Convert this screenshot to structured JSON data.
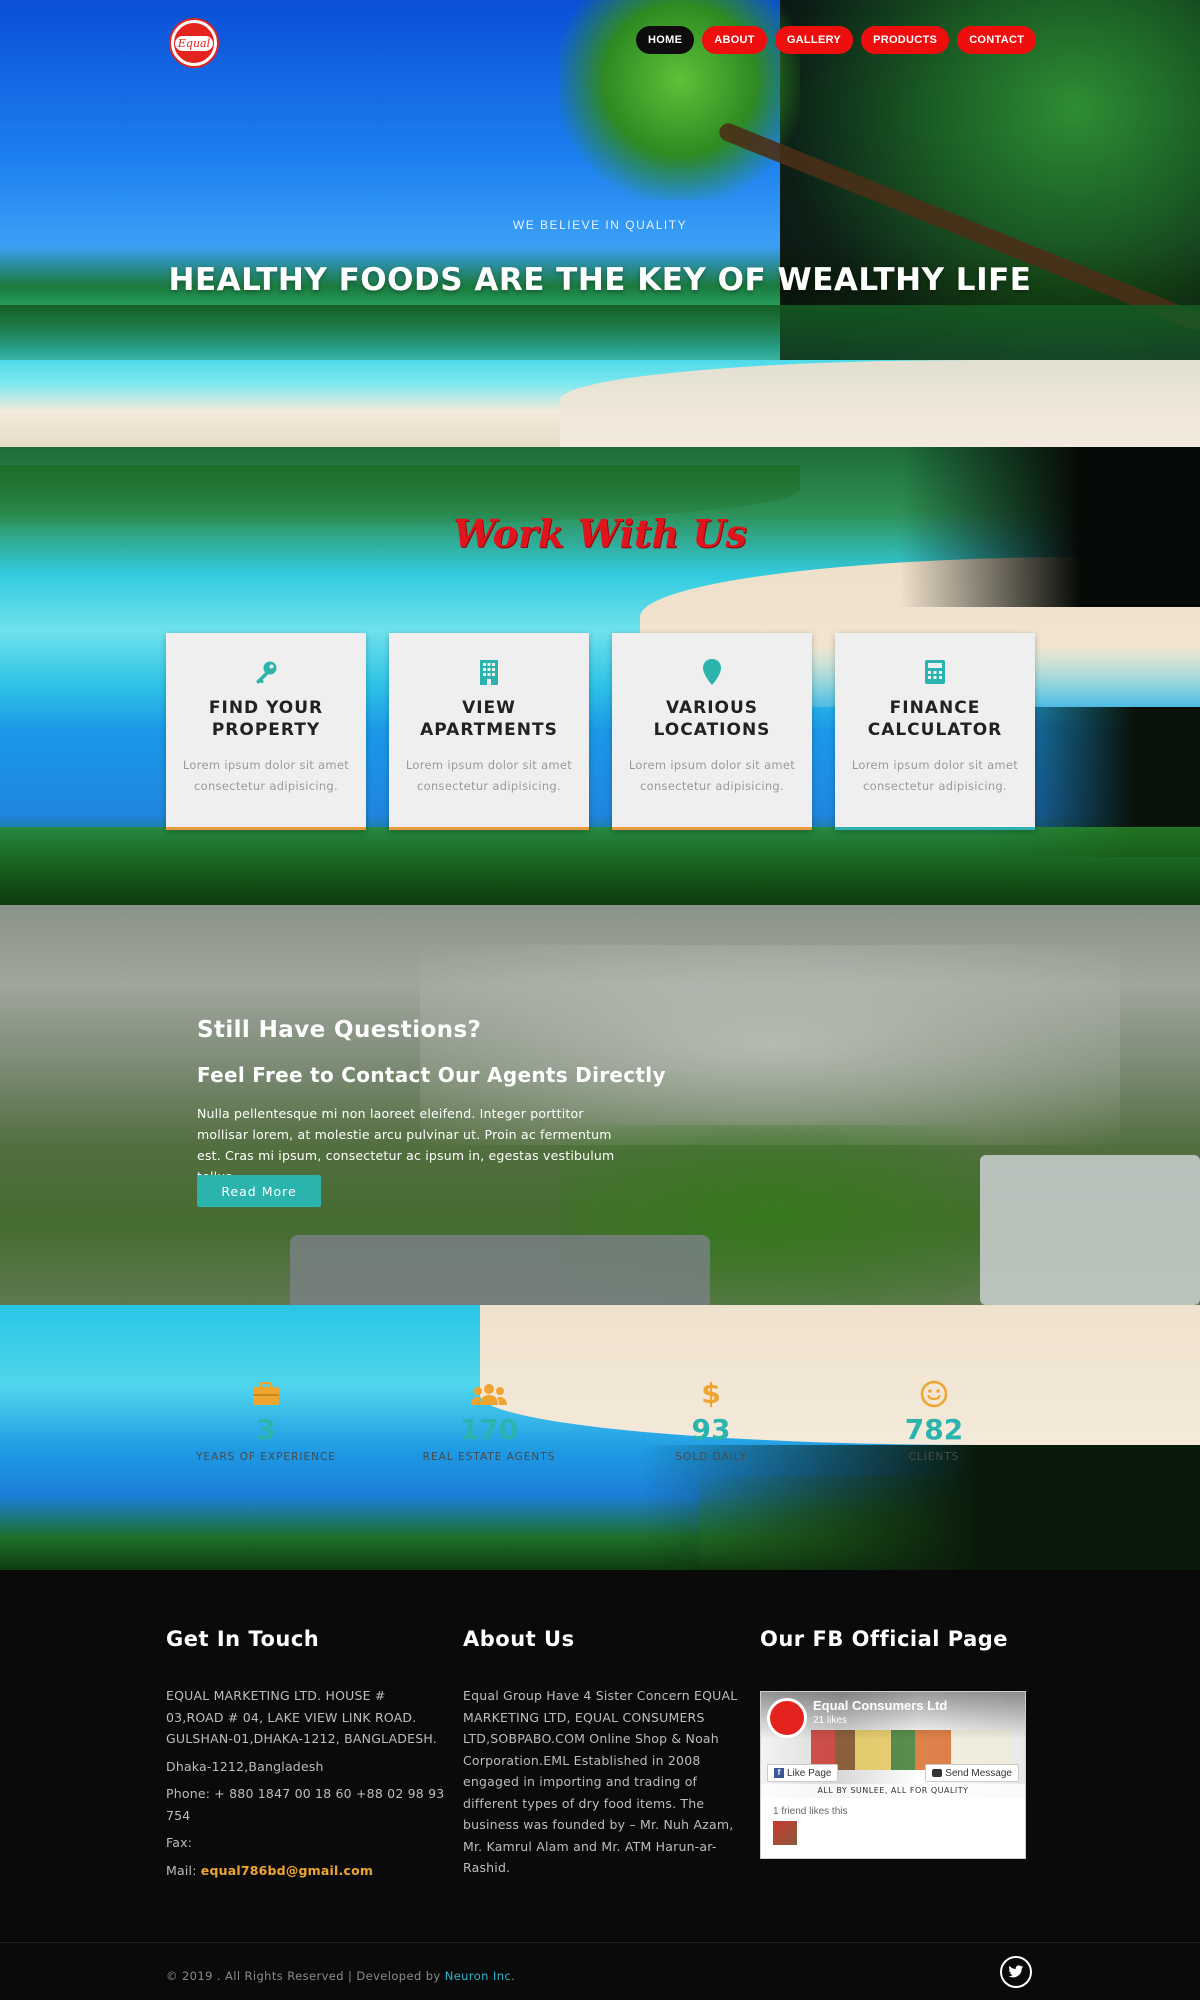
{
  "brand": {
    "logo_text": "Equal"
  },
  "nav": {
    "items": [
      {
        "label": "HOME",
        "active": true
      },
      {
        "label": "ABOUT",
        "active": false
      },
      {
        "label": "GALLERY",
        "active": false
      },
      {
        "label": "PRODUCTS",
        "active": false
      },
      {
        "label": "CONTACT",
        "active": false
      }
    ]
  },
  "hero": {
    "tagline": "WE BELIEVE IN QUALITY",
    "headline": "HEALTHY FOODS ARE THE KEY OF WEALTHY LIFE"
  },
  "work": {
    "title": "Work With Us",
    "cards": [
      {
        "icon": "key-icon",
        "title_line1": "FIND YOUR",
        "title_line2": "PROPERTY",
        "text": "Lorem ipsum dolor sit amet consectetur adipisicing."
      },
      {
        "icon": "building-icon",
        "title_line1": "VIEW",
        "title_line2": "APARTMENTS",
        "text": "Lorem ipsum dolor sit amet consectetur adipisicing."
      },
      {
        "icon": "map-marker-icon",
        "title_line1": "VARIOUS",
        "title_line2": "LOCATIONS",
        "text": "Lorem ipsum dolor sit amet consectetur adipisicing."
      },
      {
        "icon": "calculator-icon",
        "title_line1": "FINANCE",
        "title_line2": "CALCULATOR",
        "text": "Lorem ipsum dolor sit amet consectetur adipisicing."
      }
    ]
  },
  "questions": {
    "title": "Still Have Questions?",
    "subtitle": "Feel Free to Contact Our Agents Directly",
    "text": "Nulla pellentesque mi non laoreet eleifend. Integer porttitor mollisar lorem, at molestie arcu pulvinar ut. Proin ac fermentum est. Cras mi ipsum, consectetur ac ipsum in, egestas vestibulum tellus.",
    "button": "Read More"
  },
  "stats": [
    {
      "icon": "briefcase-icon",
      "value": "3",
      "label": "YEARS OF EXPERIENCE",
      "color": "#f0a530"
    },
    {
      "icon": "users-icon",
      "value": "170",
      "label": "REAL ESTATE AGENTS",
      "color": "#f0a530"
    },
    {
      "icon": "dollar-icon",
      "value": "93",
      "label": "SOLD DAILY",
      "color": "#f0a530"
    },
    {
      "icon": "smile-icon",
      "value": "782",
      "label": "CLIENTS",
      "color": "#f0a530"
    }
  ],
  "footer": {
    "contact": {
      "title": "Get In Touch",
      "address": "EQUAL MARKETING LTD. HOUSE # 03,ROAD # 04, LAKE VIEW LINK ROAD. GULSHAN-01,DHAKA-1212, BANGLADESH.",
      "city": "Dhaka-1212,Bangladesh",
      "phone": "Phone: + 880 1847 00 18 60 +88 02 98 93 754",
      "fax": "Fax:",
      "mail_label": "Mail:",
      "mail": "equal786bd@gmail.com"
    },
    "about": {
      "title": "About Us",
      "text": "Equal Group Have 4 Sister Concern EQUAL MARKETING LTD, EQUAL CONSUMERS LTD,SOBPABO.COM Online Shop & Noah Corporation.EML Established in 2008 engaged in importing and trading of different types of dry food items. The business was founded by – Mr. Nuh Azam, Mr. Kamrul Alam and Mr. ATM Harun-ar-Rashid."
    },
    "fb": {
      "title": "Our FB Official Page",
      "page_name": "Equal Consumers Ltd",
      "likes": "21 likes",
      "like_btn": "Like Page",
      "send_btn": "Send Message",
      "banner": "ALL BY SUNLEE, ALL FOR QUALITY",
      "friends": "1 friend likes this"
    },
    "copyright_prefix": "© 2019 . All Rights Reserved | Developed by",
    "developer": "Neuron Inc",
    "copyright_suffix": "."
  },
  "colors": {
    "nav_red": "#ee0e0e",
    "accent_teal": "#2bb3ad",
    "accent_orange": "#f0a530",
    "title_red": "#e0141c"
  }
}
